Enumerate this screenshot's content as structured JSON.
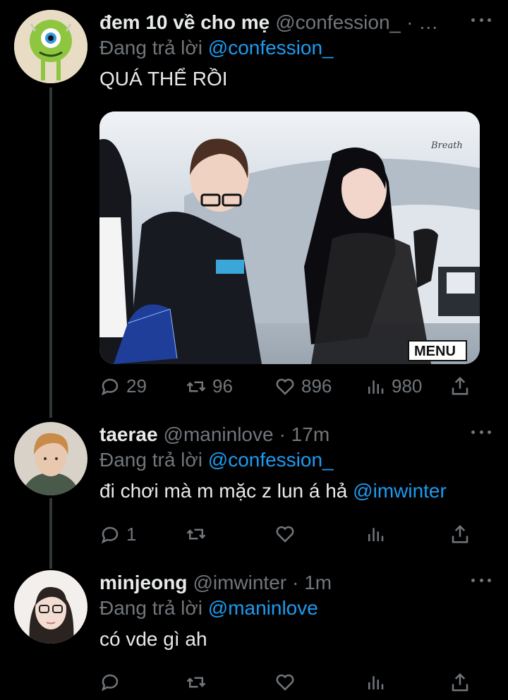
{
  "tweets": [
    {
      "name": "đem 10 về cho mẹ",
      "handle": "@confession_",
      "time": "· …",
      "reply_prefix": "Đang trả lời",
      "reply_to": "@confession_",
      "text": "QUÁ THỂ RỒI",
      "media_watermark": "Breath",
      "media_label": "MENU",
      "actions": {
        "reply": "29",
        "retweet": "96",
        "like": "896",
        "views": "980"
      }
    },
    {
      "name": "taerae",
      "handle": "@maninlove",
      "time": "· 17m",
      "reply_prefix": "Đang trả lời",
      "reply_to": "@confession_",
      "text": "đi chơi mà m mặc z lun á hả",
      "text_mention": "@imwinter",
      "actions": {
        "reply": "1",
        "retweet": "",
        "like": "",
        "views": ""
      }
    },
    {
      "name": "minjeong",
      "handle": "@imwinter",
      "time": "· 1m",
      "reply_prefix": "Đang trả lời",
      "reply_to": "@maninlove",
      "text": "có vde gì ah",
      "actions": {
        "reply": "",
        "retweet": "",
        "like": "",
        "views": ""
      }
    }
  ],
  "colors": {
    "background": "#000000",
    "text": "#e7e9ea",
    "muted": "#71767b",
    "link": "#1d9bf0",
    "thread_line": "#333639"
  }
}
